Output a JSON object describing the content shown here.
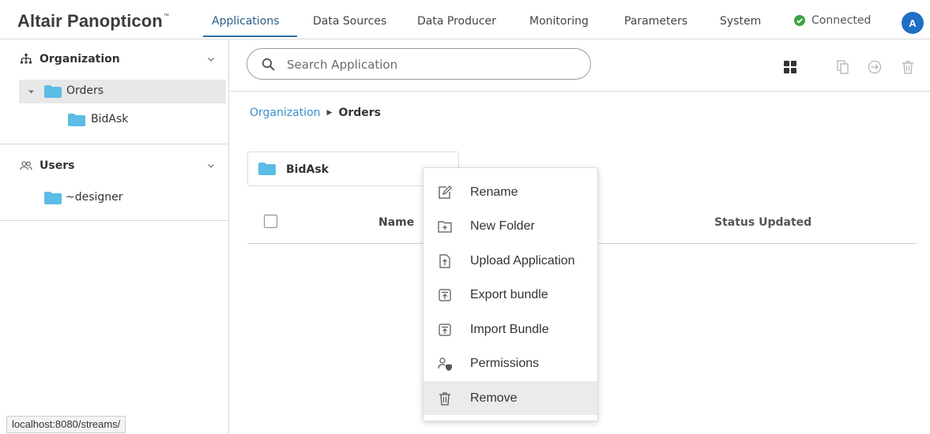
{
  "brand": {
    "name": "Altair Panopticon",
    "mark": "™"
  },
  "nav": {
    "tabs": [
      {
        "label": "Applications",
        "active": true
      },
      {
        "label": "Data Sources",
        "active": false
      },
      {
        "label": "Data Producer",
        "active": false
      },
      {
        "label": "Monitoring",
        "active": false
      },
      {
        "label": "Parameters",
        "active": false
      },
      {
        "label": "System",
        "active": false
      }
    ],
    "connection": {
      "label": "Connected",
      "color": "#3aa443"
    },
    "avatar": {
      "initial": "A",
      "color": "#1f6fc4"
    }
  },
  "sidebar": {
    "organization": {
      "title": "Organization",
      "items": [
        {
          "label": "Orders",
          "selected": true,
          "expanded": true
        },
        {
          "label": "BidAsk",
          "selected": false
        }
      ]
    },
    "users": {
      "title": "Users",
      "items": [
        {
          "label": "~designer"
        }
      ]
    }
  },
  "status_bar": {
    "url": "localhost:8080/streams/"
  },
  "main": {
    "search": {
      "placeholder": "Search Application",
      "value": ""
    },
    "toolbar": {
      "icons": [
        "grid-view-icon",
        "copy-icon",
        "move-icon",
        "delete-icon"
      ]
    },
    "breadcrumb": {
      "root": "Organization",
      "current": "Orders"
    },
    "folders": [
      {
        "label": "BidAsk"
      }
    ],
    "table": {
      "columns": [
        "Name",
        "Status Updated"
      ]
    }
  },
  "context_menu": {
    "items": [
      {
        "label": "Rename",
        "icon": "rename-icon"
      },
      {
        "label": "New Folder",
        "icon": "new-folder-icon"
      },
      {
        "label": "Upload Application",
        "icon": "upload-icon"
      },
      {
        "label": "Export bundle",
        "icon": "export-icon"
      },
      {
        "label": "Import Bundle",
        "icon": "import-icon"
      },
      {
        "label": "Permissions",
        "icon": "permissions-icon"
      },
      {
        "label": "Remove",
        "icon": "trash-icon",
        "hover": true
      }
    ]
  },
  "colors": {
    "accent": "#2f6fa3",
    "link": "#3b8fc9",
    "folder": "#5bbce6"
  }
}
